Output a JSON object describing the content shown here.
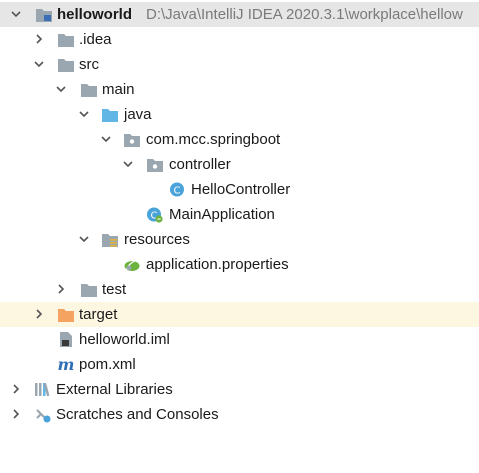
{
  "project_tree": {
    "root": {
      "name": "helloworld",
      "path": "D:\\Java\\IntelliJ IDEA 2020.3.1\\workplace\\hellow"
    },
    "items": [
      {
        "label": "helloworld"
      },
      {
        "label": ".idea"
      },
      {
        "label": "src"
      },
      {
        "label": "main"
      },
      {
        "label": "java"
      },
      {
        "label": "com.mcc.springboot"
      },
      {
        "label": "controller"
      },
      {
        "label": "HelloController"
      },
      {
        "label": "MainApplication"
      },
      {
        "label": "resources"
      },
      {
        "label": "application.properties"
      },
      {
        "label": "test"
      },
      {
        "label": "target"
      },
      {
        "label": "helloworld.iml"
      },
      {
        "label": "pom.xml"
      },
      {
        "label": "External Libraries"
      },
      {
        "label": "Scratches and Consoles"
      }
    ]
  },
  "colors": {
    "selected_row": "#e6e6e6",
    "excluded_row": "#fdf7e1",
    "folder_gray": "#9aa7b0",
    "source_folder_blue": "#62b6e6",
    "excluded_folder_orange": "#f4a460",
    "class_icon_blue": "#4aa3d9",
    "spring_green": "#6db33f",
    "maven_blue": "#2f6fb5"
  }
}
